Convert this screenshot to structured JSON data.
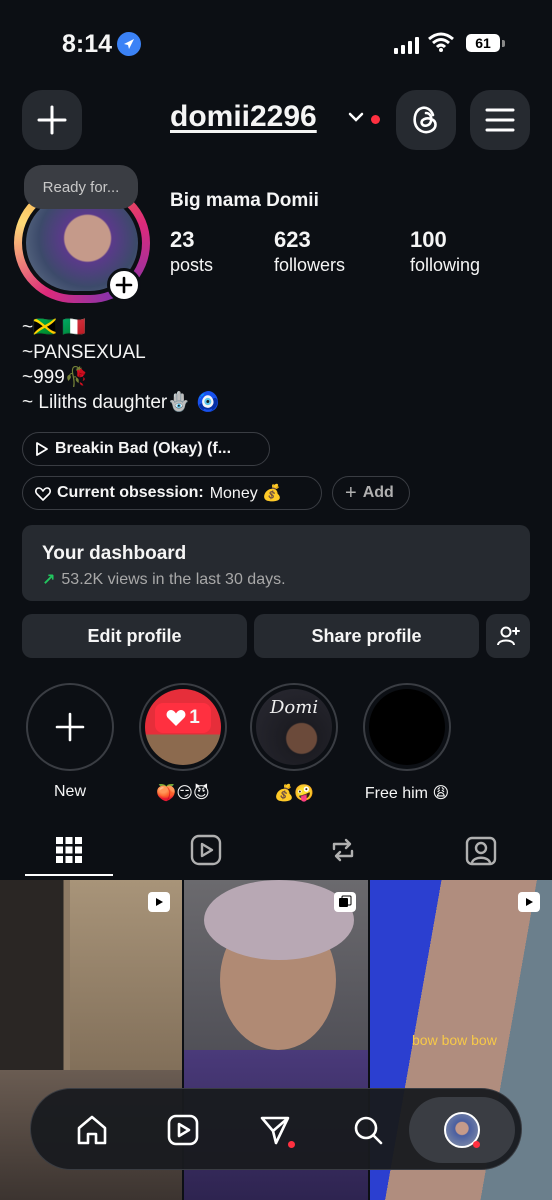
{
  "status_bar": {
    "time": "8:14",
    "battery": "61"
  },
  "header": {
    "username": "domii2296"
  },
  "profile": {
    "note": "Ready for...",
    "display_name": "Big mama Domii",
    "stats": [
      {
        "value": "23",
        "label": "posts"
      },
      {
        "value": "623",
        "label": "followers"
      },
      {
        "value": "100",
        "label": "following"
      }
    ],
    "bio": [
      "~🇯🇲 🇮🇹",
      "~PANSEXUAL",
      "~999🥀",
      "~ Liliths daughter🪬 🧿"
    ]
  },
  "music": {
    "label": "Breakin Bad (Okay) (f..."
  },
  "obsession": {
    "label": "Current obsession:",
    "value": "Money 💰"
  },
  "add_button": {
    "label": "Add"
  },
  "dashboard": {
    "title": "Your dashboard",
    "subtitle": "53.2K views in the last 30 days."
  },
  "buttons": {
    "edit": "Edit profile",
    "share": "Share profile"
  },
  "highlights": [
    {
      "label": "New"
    },
    {
      "label": "🍑😏😈",
      "badge": "1"
    },
    {
      "label": "💰🤪",
      "cover_text": "Domi"
    },
    {
      "label": "Free him 😩"
    }
  ],
  "grid": {
    "caption": "bow bow bow"
  },
  "colors": {
    "accent_red": "#ff3040",
    "accent_green": "#22c55e",
    "caption_yellow": "#f7c948"
  }
}
